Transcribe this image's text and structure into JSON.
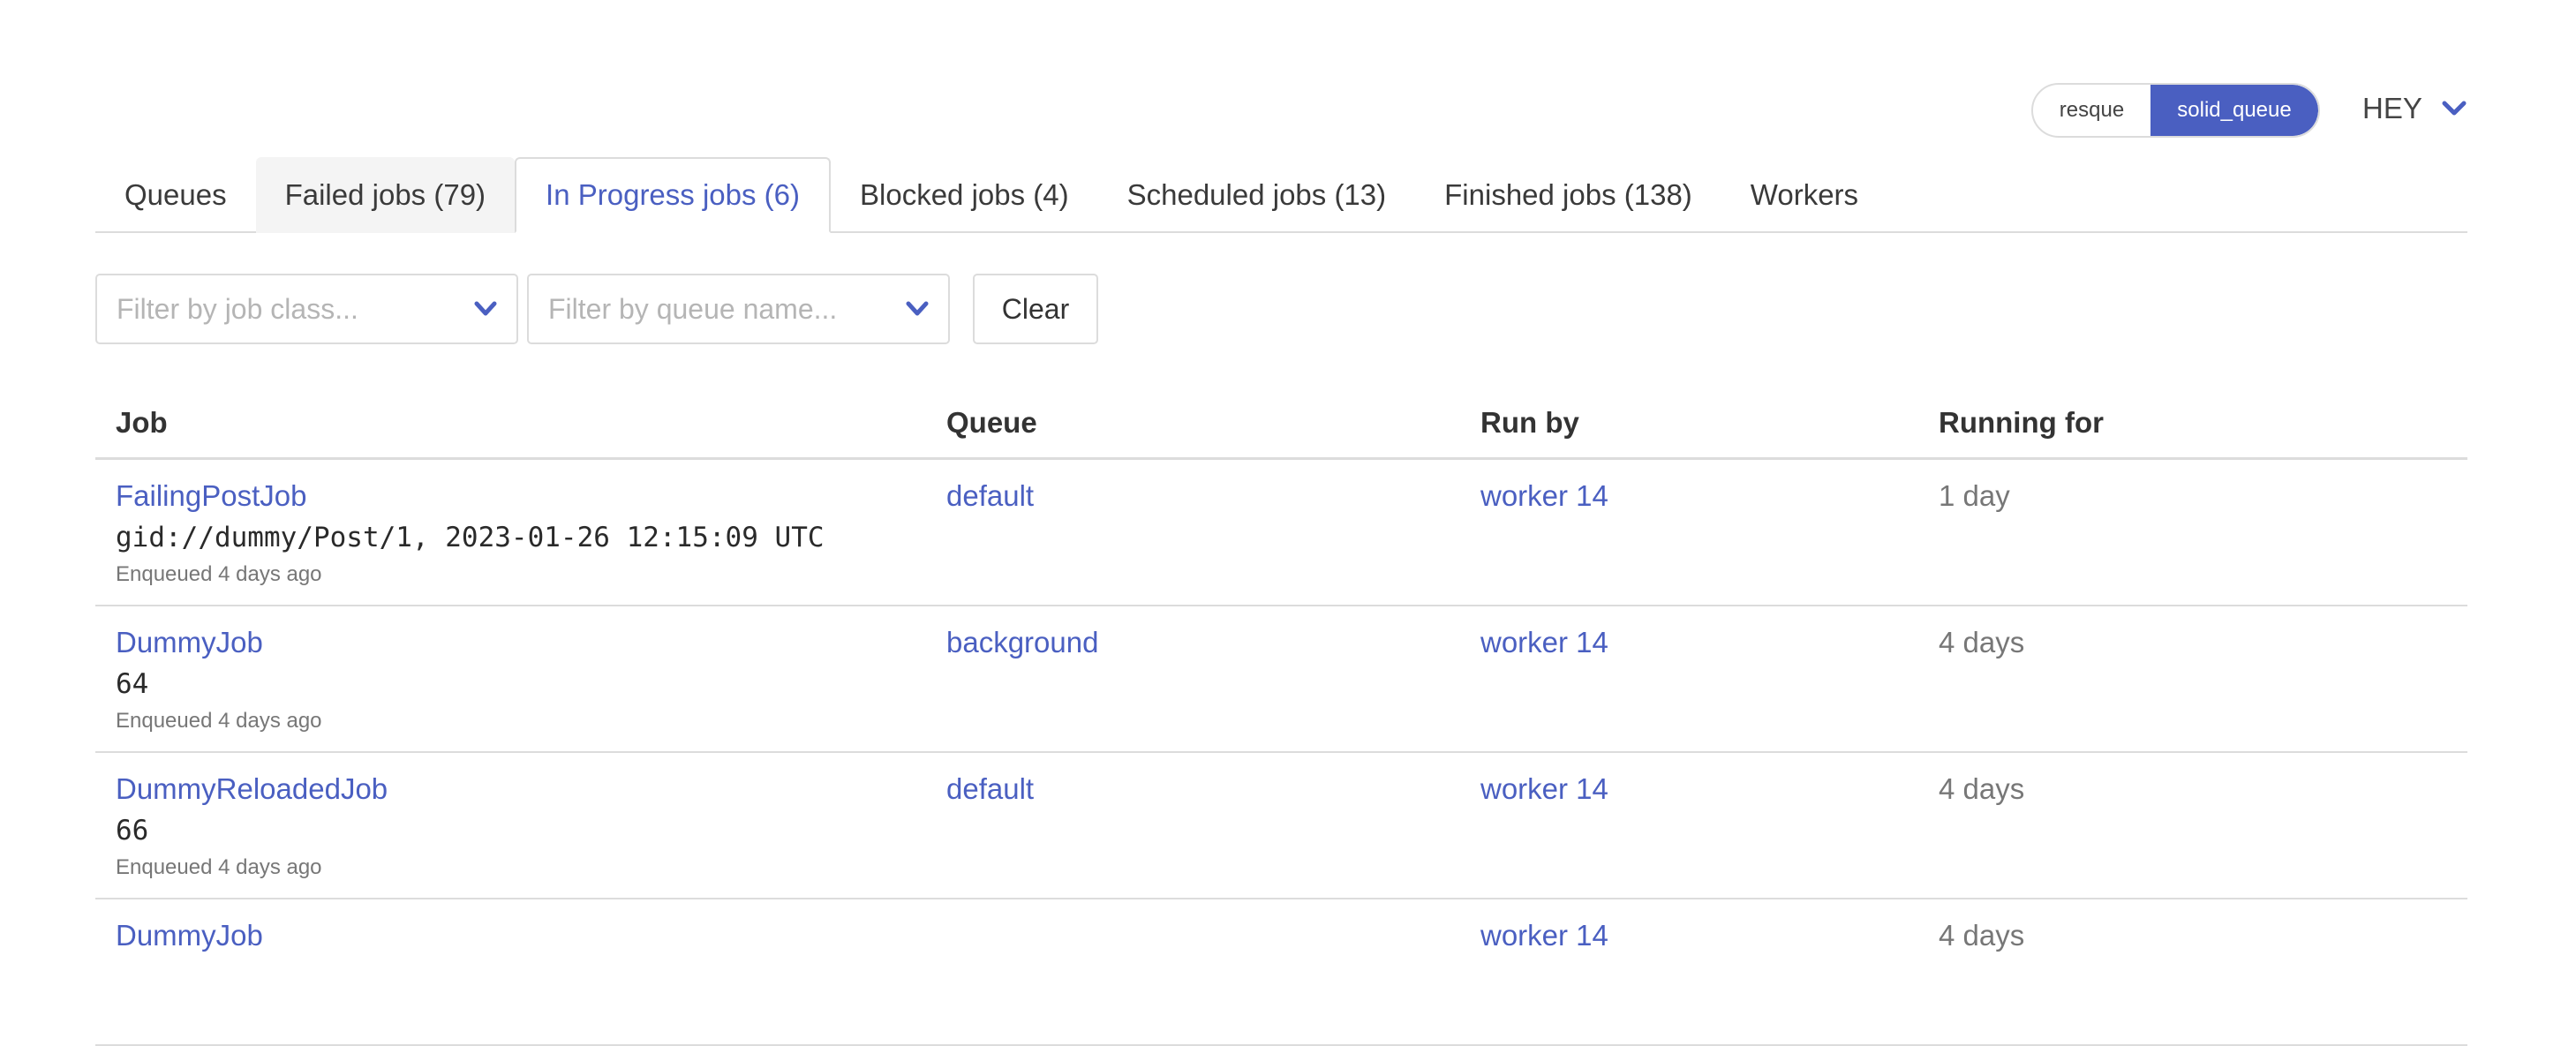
{
  "backend_switcher": {
    "options": [
      {
        "label": "resque",
        "active": false
      },
      {
        "label": "solid_queue",
        "active": true
      }
    ]
  },
  "app_menu": {
    "label": "HEY",
    "icon": "chevron-down-icon"
  },
  "tabs": [
    {
      "label": "Queues",
      "state": "default"
    },
    {
      "label": "Failed jobs (79)",
      "state": "hovered"
    },
    {
      "label": "In Progress jobs (6)",
      "state": "active"
    },
    {
      "label": "Blocked jobs (4)",
      "state": "default"
    },
    {
      "label": "Scheduled jobs (13)",
      "state": "default"
    },
    {
      "label": "Finished jobs (138)",
      "state": "default"
    },
    {
      "label": "Workers",
      "state": "default"
    }
  ],
  "filters": {
    "job_class_placeholder": "Filter by job class...",
    "queue_name_placeholder": "Filter by queue name...",
    "clear_label": "Clear"
  },
  "table": {
    "headers": {
      "job": "Job",
      "queue": "Queue",
      "run_by": "Run by",
      "running_for": "Running for"
    },
    "rows": [
      {
        "job": "FailingPostJob",
        "args": "gid://dummy/Post/1, 2023-01-26 12:15:09 UTC",
        "enqueued": "Enqueued 4 days ago",
        "queue": "default",
        "run_by": "worker 14",
        "running_for": "1 day"
      },
      {
        "job": "DummyJob",
        "args": "64",
        "enqueued": "Enqueued 4 days ago",
        "queue": "background",
        "run_by": "worker 14",
        "running_for": "4 days"
      },
      {
        "job": "DummyReloadedJob",
        "args": "66",
        "enqueued": "Enqueued 4 days ago",
        "queue": "default",
        "run_by": "worker 14",
        "running_for": "4 days"
      },
      {
        "job": "DummyJob",
        "args": "",
        "enqueued": "",
        "queue": "",
        "run_by": "worker 14",
        "running_for": "4 days"
      }
    ]
  },
  "colors": {
    "accent": "#4a5fc1",
    "border": "#dcdcdc",
    "hover_tab_bg": "#f4f4f4"
  }
}
